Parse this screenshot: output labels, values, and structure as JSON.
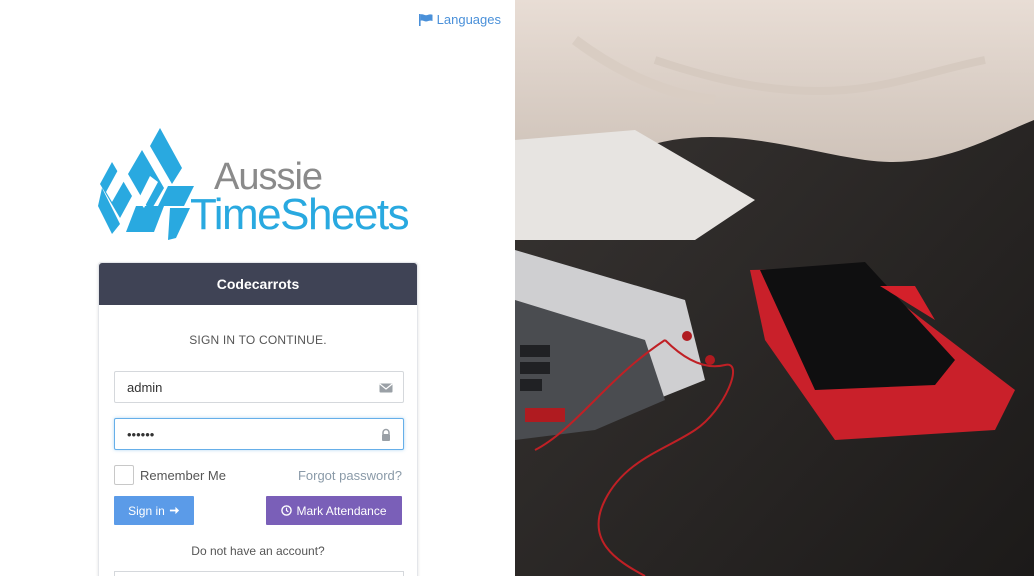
{
  "header": {
    "languages_label": "Languages"
  },
  "logo": {
    "line1": "Aussie",
    "line2": "TimeSheets",
    "mark_color": "#29a9e0",
    "text_gray": "#8a8a8a"
  },
  "login_card": {
    "company_name": "Codecarrots",
    "subtitle": "SIGN IN TO CONTINUE.",
    "username_value": "admin",
    "password_value": "••••••",
    "remember_label": "Remember Me",
    "forgot_label": "Forgot password?",
    "signin_label": "Sign in",
    "attendance_label": "Mark Attendance",
    "no_account_text": "Do not have an account?"
  },
  "colors": {
    "header_bg": "#3f4355",
    "signin_btn": "#5b9be8",
    "attendance_btn": "#7a5fb8",
    "link": "#4a90d9"
  },
  "icons": {
    "languages": "flag-icon",
    "username": "envelope-icon",
    "password": "lock-icon",
    "signin": "arrow-right-icon",
    "attendance": "clock-icon"
  }
}
